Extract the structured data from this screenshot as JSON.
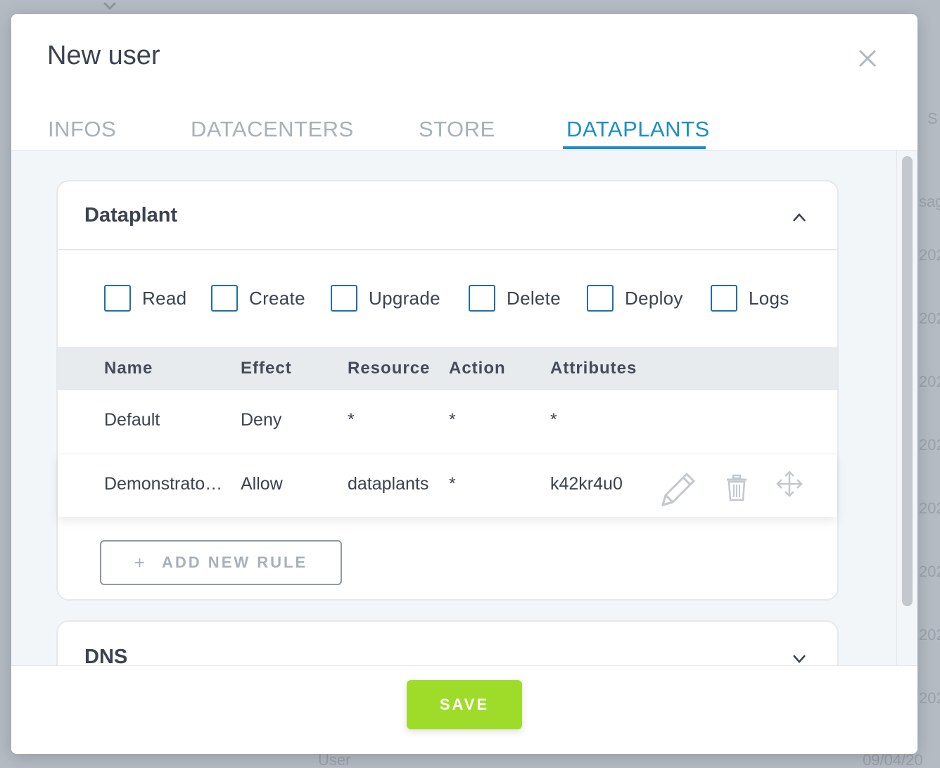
{
  "background": {
    "fragments": [
      "S",
      "sag",
      "202",
      "202",
      "202",
      "202",
      "202",
      "202",
      "202",
      "202",
      "User",
      "09/04/20"
    ]
  },
  "modal": {
    "title": "New user",
    "tabs": [
      {
        "label": "INFOS",
        "active": false
      },
      {
        "label": "DATACENTERS",
        "active": false
      },
      {
        "label": "STORE",
        "active": false
      },
      {
        "label": "DATAPLANTS",
        "active": true
      }
    ],
    "accent_color": "#1b8fc6"
  },
  "dataplant_section": {
    "title": "Dataplant",
    "expanded": true,
    "permissions": [
      {
        "label": "Read",
        "checked": false
      },
      {
        "label": "Create",
        "checked": false
      },
      {
        "label": "Upgrade",
        "checked": false
      },
      {
        "label": "Delete",
        "checked": false
      },
      {
        "label": "Deploy",
        "checked": false
      },
      {
        "label": "Logs",
        "checked": false
      }
    ],
    "table": {
      "headers": [
        "Name",
        "Effect",
        "Resource",
        "Action",
        "Attributes"
      ],
      "rows": [
        {
          "name": "Default",
          "effect": "Deny",
          "resource": "*",
          "action": "*",
          "attributes": "*"
        },
        {
          "name": "Demonstrato…",
          "effect": "Allow",
          "resource": "dataplants",
          "action": "*",
          "attributes": "k42kr4u0",
          "icons": [
            "pencil-icon",
            "trash-icon",
            "move-icon"
          ]
        }
      ]
    },
    "add_rule": {
      "plus": "+",
      "label": "ADD NEW RULE"
    }
  },
  "dns_section": {
    "title": "DNS",
    "expanded": false
  },
  "footer": {
    "save_label": "SAVE",
    "save_color": "#9fdc2a"
  }
}
